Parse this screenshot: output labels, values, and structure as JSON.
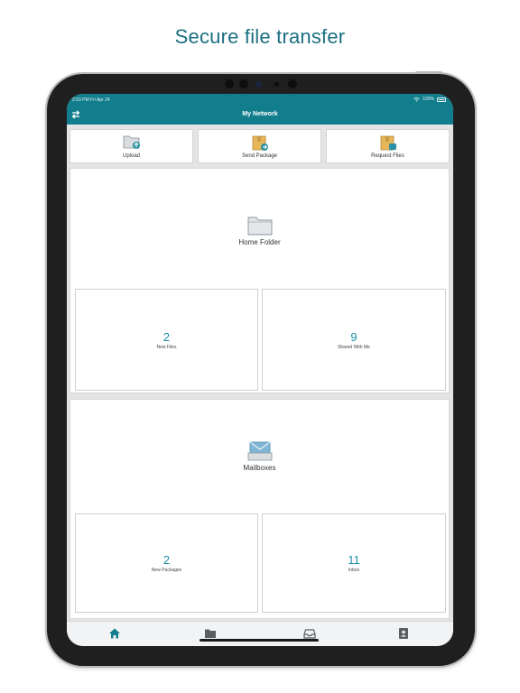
{
  "headline": "Secure file transfer",
  "status": {
    "time": "2:03 PM   Fri Apr 24",
    "battery": "100%"
  },
  "nav": {
    "title": "My Network"
  },
  "actions": [
    {
      "label": "Upload",
      "icon": "folder-upload-icon"
    },
    {
      "label": "Send Package",
      "icon": "package-send-icon"
    },
    {
      "label": "Request Files",
      "icon": "package-request-icon"
    }
  ],
  "home": {
    "title": "Home Folder",
    "tiles": [
      {
        "count": "2",
        "label": "New Files"
      },
      {
        "count": "9",
        "label": "Shared With Me"
      }
    ]
  },
  "mail": {
    "title": "Mailboxes",
    "tiles": [
      {
        "count": "2",
        "label": "New Packages"
      },
      {
        "count": "11",
        "label": "Inbox"
      }
    ]
  },
  "tabs": [
    "home-icon",
    "folder-icon",
    "inbox-icon",
    "contacts-icon"
  ],
  "colors": {
    "accent": "#127e8d",
    "count": "#1a8ea3",
    "headline": "#1c6f82"
  }
}
